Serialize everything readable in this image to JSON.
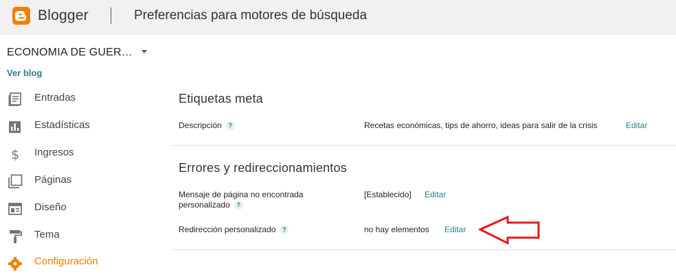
{
  "header": {
    "brand": "Blogger",
    "page_title": "Preferencias para motores de búsqueda",
    "brand_color": "#f57d00"
  },
  "sidebar": {
    "blog_name": "ECONOMIA DE GUER…",
    "view_blog": "Ver blog",
    "items": [
      {
        "label": "Entradas",
        "icon": "posts-icon"
      },
      {
        "label": "Estadísticas",
        "icon": "stats-icon"
      },
      {
        "label": "Ingresos",
        "icon": "dollar-icon"
      },
      {
        "label": "Páginas",
        "icon": "pages-icon"
      },
      {
        "label": "Diseño",
        "icon": "layout-icon"
      },
      {
        "label": "Tema",
        "icon": "paint-roller-icon"
      },
      {
        "label": "Configuración",
        "icon": "gear-icon",
        "active": true
      }
    ]
  },
  "main": {
    "meta_section": {
      "title": "Etiquetas meta",
      "description_label": "Descripción",
      "description_value": "Recetas económicas, tips de ahorro, ideas para salir de la crisis",
      "edit_label": "Editar"
    },
    "errors_section": {
      "title": "Errores y redireccionamientos",
      "not_found_label_1": "Mensaje de página no encontrada",
      "not_found_label_2": "personalizado",
      "not_found_value": "[Establecido]",
      "redirect_label": "Redirección personalizado",
      "redirect_value": "no hay elementos",
      "edit_label": "Editar"
    },
    "help_glyph": "?"
  },
  "colors": {
    "link": "#2a7c8c",
    "annotation_arrow": "#e8141a"
  }
}
